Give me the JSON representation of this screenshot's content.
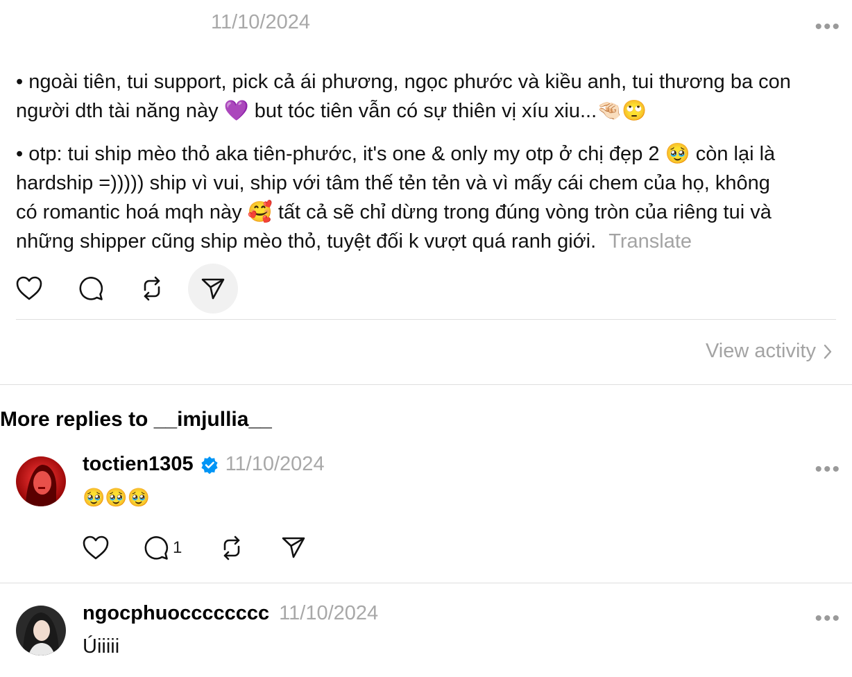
{
  "post": {
    "date": "11/10/2024",
    "more_label": "•••",
    "paragraph1_line1": "• ngoài tiên, tui support, pick cả ái phương, ngọc phước và kiều anh, tui thương ba con",
    "paragraph1_line2": "người dth tài năng này 💜 but tóc tiên vẫn có sự thiên vị xíu xiu...🤏🏻🙄",
    "paragraph2_line1": "• otp: tui ship mèo thỏ aka tiên-phước, it's one & only my otp ở chị đẹp 2 🥹 còn lại là",
    "paragraph2_line2": "hardship =))))) ship vì vui, ship với tâm thế tẻn tẻn và vì mấy cái chem của họ, không",
    "paragraph2_line3": "có romantic hoá mqh này 🥰 tất cả sẽ chỉ dừng trong đúng vòng tròn của riêng tui và",
    "paragraph2_line4": "những shipper cũng ship mèo thỏ, tuyệt đối k vượt quá ranh giới.",
    "translate_label": "Translate",
    "view_activity_label": "View activity"
  },
  "section_title": "More replies to __imjullia__",
  "replies": [
    {
      "username": "toctien1305",
      "verified": true,
      "date": "11/10/2024",
      "text": "🥹🥹🥹",
      "reply_count": "1",
      "more_label": "•••"
    },
    {
      "username": "ngocphuocccccccc",
      "verified": false,
      "date": "11/10/2024",
      "text": "Úiiiii",
      "more_label": "•••"
    }
  ],
  "colors": {
    "verified_blue": "#0095f6",
    "muted_gray": "#a3a3a3",
    "divider": "#dedede"
  },
  "icons": [
    "heart-icon",
    "comment-icon",
    "repost-icon",
    "share-icon",
    "verified-icon",
    "chevron-right-icon",
    "more-icon"
  ]
}
